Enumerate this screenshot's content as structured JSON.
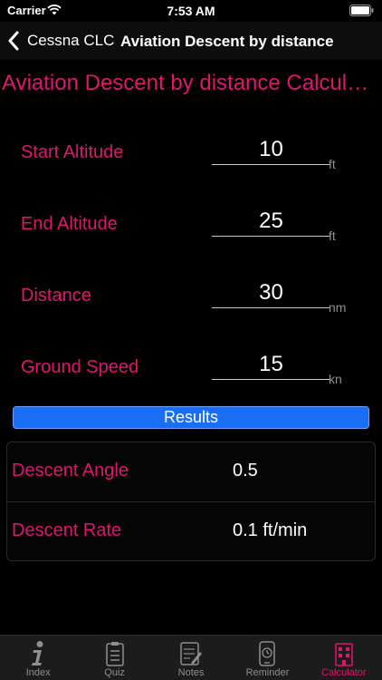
{
  "status": {
    "carrier": "Carrier",
    "time": "7:53 AM"
  },
  "nav": {
    "back_label": "Cessna CLC",
    "title": "Aviation Descent by distance"
  },
  "page": {
    "title": "Aviation Descent by distance Calculator"
  },
  "fields": [
    {
      "label": "Start Altitude",
      "value": "10",
      "unit": "ft"
    },
    {
      "label": "End Altitude",
      "value": "25",
      "unit": "ft"
    },
    {
      "label": "Distance",
      "value": "30",
      "unit": "nm"
    },
    {
      "label": "Ground Speed",
      "value": "15",
      "unit": "kn"
    }
  ],
  "results_button": {
    "label": "Results"
  },
  "results": [
    {
      "label": "Descent Angle",
      "value": "0.5"
    },
    {
      "label": "Descent Rate",
      "value": "0.1 ft/min"
    }
  ],
  "tabs": [
    {
      "label": "Index",
      "icon": "info-icon"
    },
    {
      "label": "Quiz",
      "icon": "quiz-clipboard-icon"
    },
    {
      "label": "Notes",
      "icon": "notes-icon"
    },
    {
      "label": "Reminder",
      "icon": "reminder-phone-icon"
    },
    {
      "label": "Calculator",
      "icon": "calculator-building-icon",
      "active": true
    }
  ],
  "colors": {
    "accent": "#e0156e",
    "button": "#1a6ef3",
    "background": "#000000"
  }
}
